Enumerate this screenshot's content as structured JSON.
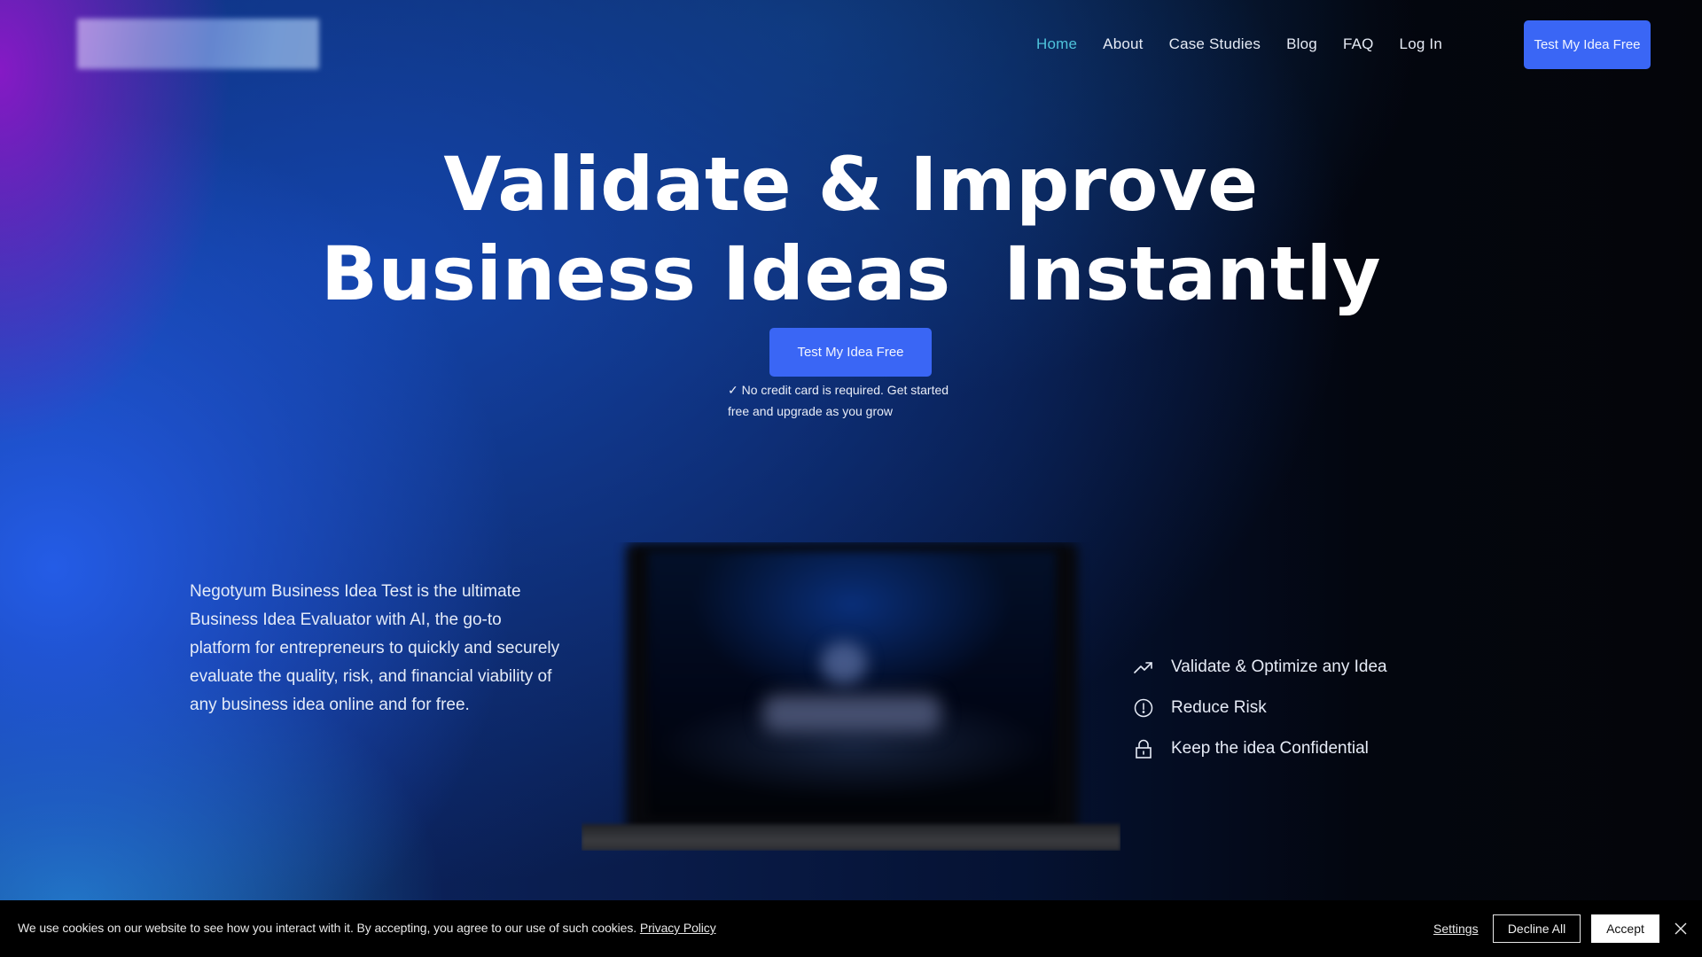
{
  "header": {
    "logo_alt": "Negotyum",
    "nav": [
      {
        "label": "Home",
        "active": true
      },
      {
        "label": "About",
        "active": false
      },
      {
        "label": "Case Studies",
        "active": false
      },
      {
        "label": "Blog",
        "active": false
      },
      {
        "label": "FAQ",
        "active": false
      },
      {
        "label": "Log In",
        "active": false
      }
    ],
    "cta_label": "Test My Idea Free"
  },
  "hero": {
    "title_line1": "Validate & Improve",
    "title_line2": "Business Ideas  Instantly",
    "cta_label": "Test My Idea Free",
    "subtext": "✓ No credit card is required. Get started free and upgrade as you grow"
  },
  "description": "Negotyum Business Idea Test is the ultimate Business Idea Evaluator with AI,  the go-to platform for entrepreneurs to quickly and securely evaluate the quality, risk, and financial viability of any business idea online and for free.",
  "features": [
    {
      "icon": "trend-up-icon",
      "label": "Validate & Optimize any Idea"
    },
    {
      "icon": "alert-circle-icon",
      "label": "Reduce Risk"
    },
    {
      "icon": "lock-icon",
      "label": "Keep the idea Confidential"
    }
  ],
  "cookie_banner": {
    "message": "We use cookies on our website to see how you interact with it. By accepting, you agree to our use of such cookies.",
    "privacy_link": "Privacy Policy",
    "settings_label": "Settings",
    "decline_label": "Decline All",
    "accept_label": "Accept"
  },
  "colors": {
    "accent": "#3a66f5",
    "nav_active": "#4ec3db",
    "cookie_bg": "#000000"
  }
}
